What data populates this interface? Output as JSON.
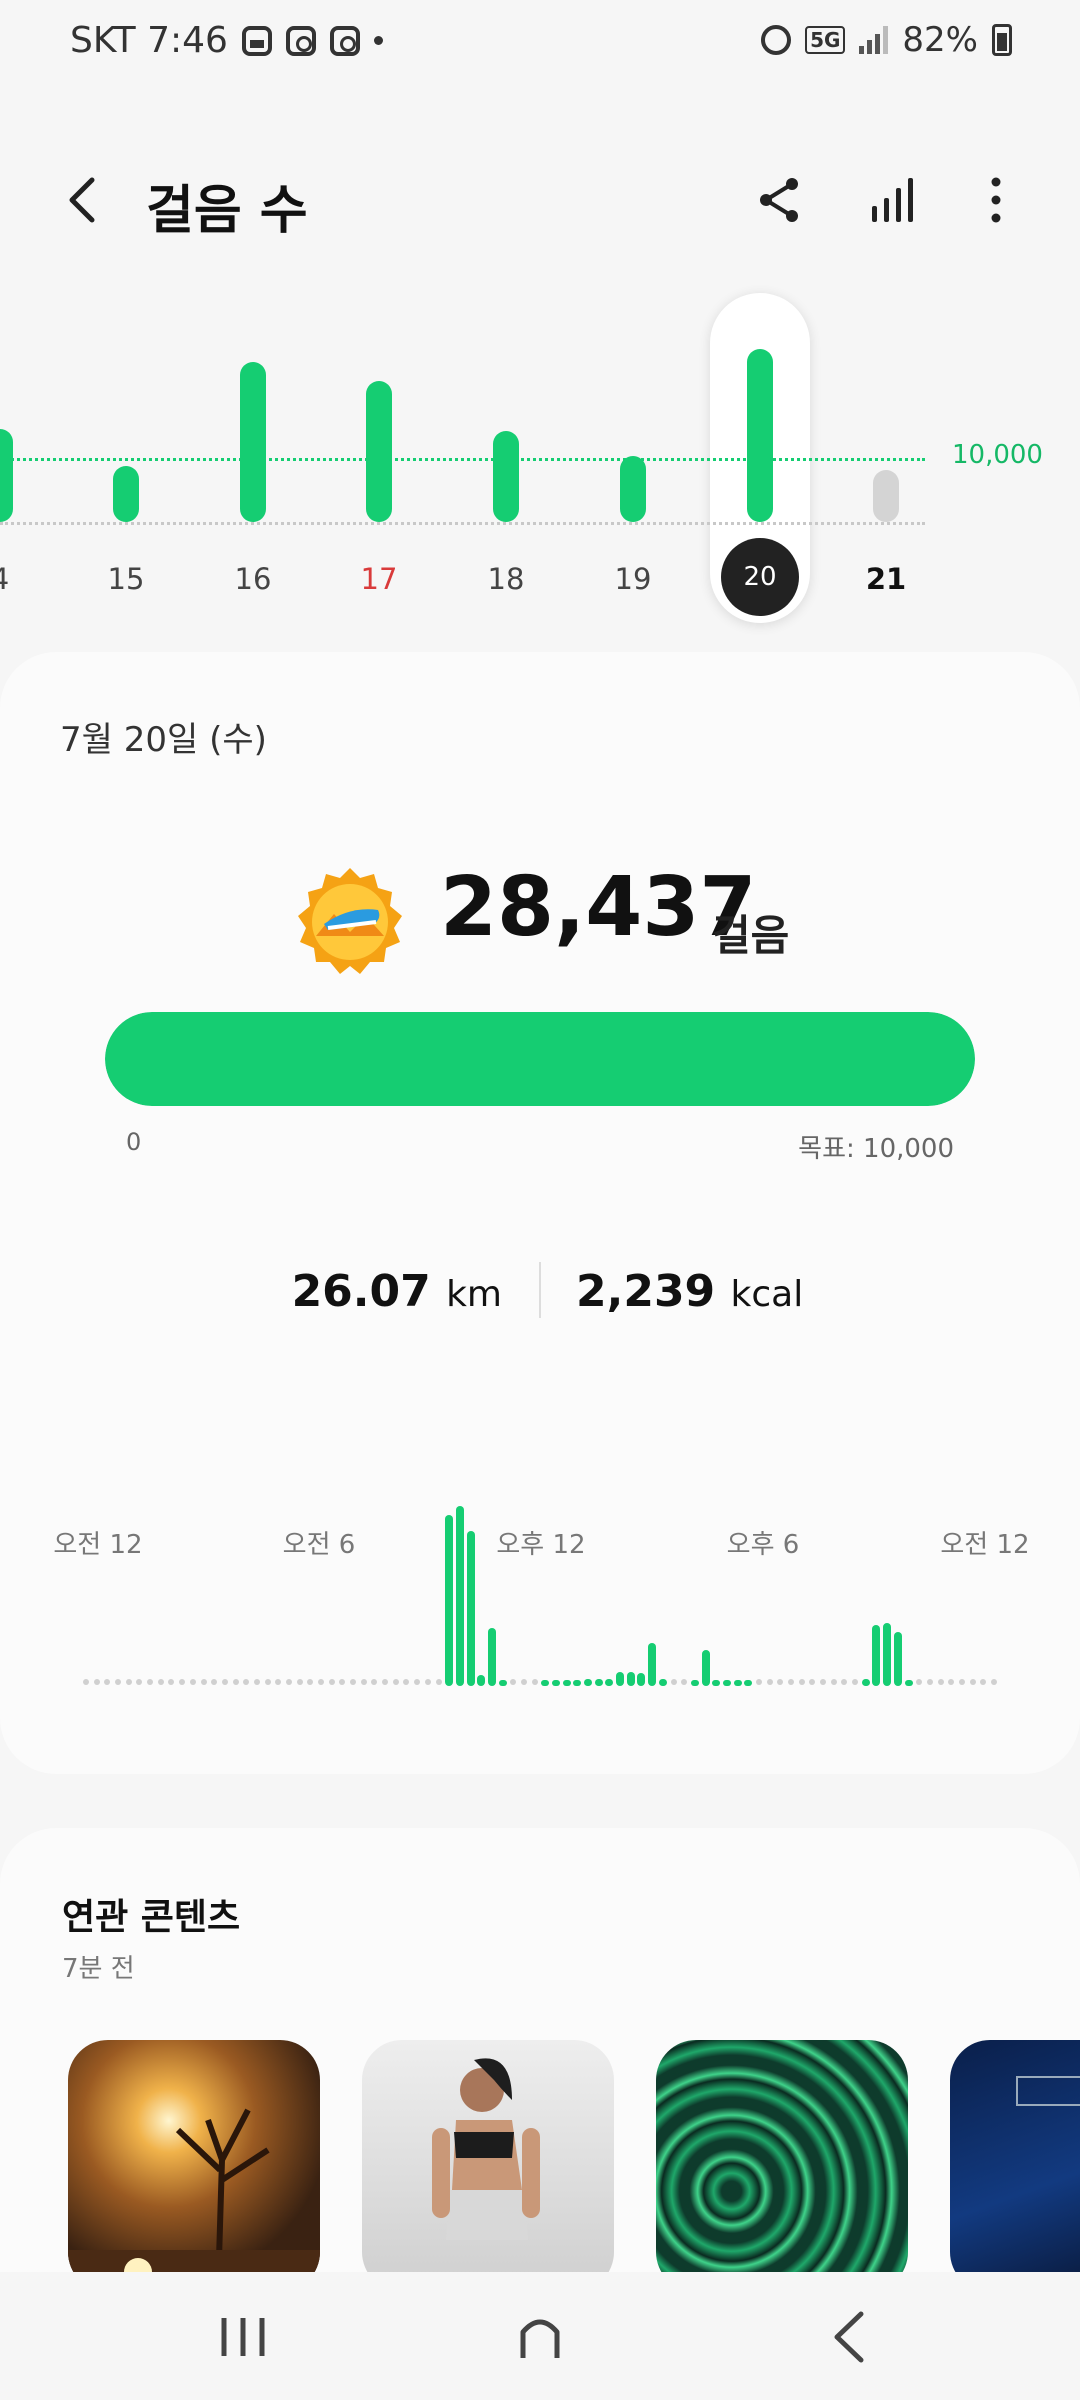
{
  "status_bar": {
    "carrier_time": "SKT 7:46",
    "network": "5G",
    "battery": "82%",
    "icons": [
      "gallery-icon",
      "instagram-icon",
      "instagram-icon",
      "dot-icon",
      "alarm-icon",
      "signal-icon",
      "battery-icon"
    ]
  },
  "header": {
    "title": "걸음 수",
    "icons": [
      "back-icon",
      "share-icon",
      "bar-chart-icon",
      "more-icon"
    ]
  },
  "week_chart": {
    "goal_label": "10,000",
    "days": [
      "4",
      "15",
      "16",
      "17",
      "18",
      "19",
      "20",
      "21"
    ],
    "selected_day": "20",
    "sunday_day": "17",
    "today_day": "21",
    "bar_levels": [
      0.58,
      0.35,
      1.0,
      0.88,
      0.57,
      0.41,
      1.08,
      0.3
    ]
  },
  "summary": {
    "date": "7월 20일 (수)",
    "steps": "28,437",
    "steps_unit": "걸음",
    "progress_min": "0",
    "goal": "목표: 10,000",
    "progress_fraction": 1.0,
    "distance_value": "26.07",
    "distance_unit": "km",
    "calories_value": "2,239",
    "calories_unit": "kcal",
    "hour_labels": [
      "오전 12",
      "오전 6",
      "오후 12",
      "오후 6",
      "오전 12"
    ]
  },
  "chart_data": {
    "type": "bar",
    "title": "",
    "xlabel": "",
    "ylabel": "",
    "x": [
      "오전 12",
      "오전 6",
      "오후 12",
      "오후 6",
      "오전 12"
    ],
    "hourly_levels": [
      0,
      0,
      0,
      0,
      0,
      0,
      0,
      0,
      0,
      0,
      0,
      0,
      0,
      0,
      0,
      0,
      0,
      0,
      0,
      0,
      0,
      0,
      0,
      0,
      0,
      0,
      0,
      0,
      0,
      0,
      0,
      0,
      0,
      0,
      0.95,
      1.0,
      0.86,
      0.06,
      0.32,
      0.02,
      0,
      0,
      0,
      0.02,
      0.02,
      0.02,
      0.02,
      0.04,
      0.04,
      0.04,
      0.08,
      0.08,
      0.07,
      0.24,
      0.04,
      0,
      0,
      0.02,
      0.2,
      0.02,
      0.02,
      0.02,
      0.02,
      0,
      0,
      0,
      0,
      0,
      0,
      0,
      0,
      0,
      0,
      0.04,
      0.34,
      0.35,
      0.3,
      0.02,
      0,
      0,
      0,
      0,
      0,
      0,
      0,
      0
    ]
  },
  "related": {
    "title": "연관 콘텐츠",
    "time": "7분 전",
    "items": [
      "sunset-thumbnail",
      "fitness-thumbnail",
      "green-abstract-thumbnail",
      "music-thumbnail"
    ]
  },
  "colors": {
    "accent": "#15cd72",
    "weekend": "#d93a3a",
    "future_bar": "#d4d4d4"
  },
  "nav_bar": {
    "buttons": [
      "recents-button",
      "home-button",
      "back-button"
    ]
  }
}
